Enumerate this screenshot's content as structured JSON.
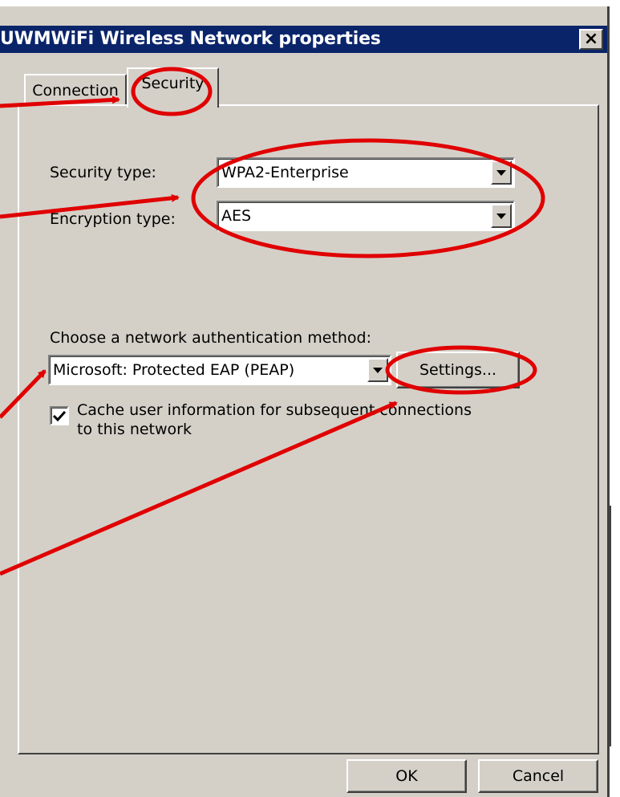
{
  "window": {
    "title": "UWMWiFi Wireless Network properties",
    "close_glyph": "×"
  },
  "tabs": [
    {
      "label": "Connection",
      "selected": false
    },
    {
      "label": "Security",
      "selected": true
    }
  ],
  "security": {
    "security_type_label": "Security type:",
    "security_type_value": "WPA2-Enterprise",
    "encryption_type_label": "Encryption type:",
    "encryption_type_value": "AES",
    "auth_method_label": "Choose a network authentication method:",
    "auth_method_value": "Microsoft: Protected EAP (PEAP)",
    "settings_button": "Settings...",
    "cache_checkbox_checked": true,
    "cache_label_line1": "Cache user information for subsequent connections",
    "cache_label_line2": "to this network"
  },
  "footer": {
    "ok_button": "OK",
    "cancel_button": "Cancel"
  },
  "behind_window": {
    "close_glyph": "×"
  },
  "colors": {
    "titlebar": "#0a246a",
    "face": "#d4d0c8",
    "annotation_red": "#e00000"
  },
  "icons": {
    "checkbox_mark": "check-icon",
    "dropdown": "chevron-down-icon"
  }
}
